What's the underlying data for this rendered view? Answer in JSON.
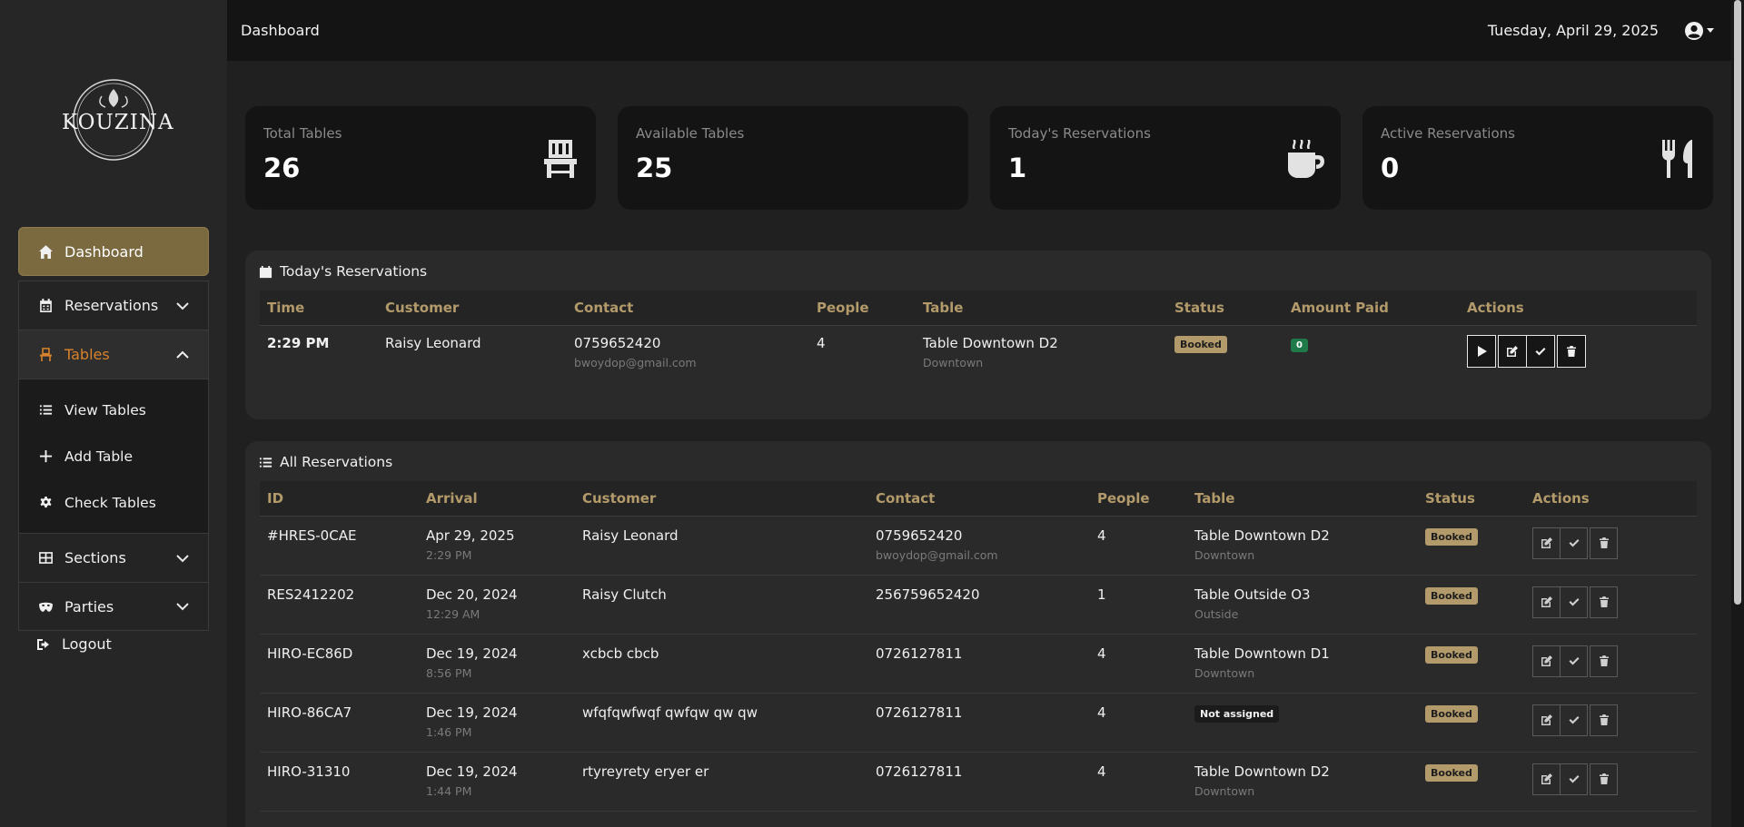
{
  "brand": {
    "logo_text": "KOUZINA"
  },
  "sidebar": {
    "items": [
      {
        "label": "Dashboard"
      },
      {
        "label": "Reservations"
      },
      {
        "label": "Tables"
      },
      {
        "label": "Sections"
      },
      {
        "label": "Parties"
      }
    ],
    "tables_sub": [
      {
        "label": "View Tables"
      },
      {
        "label": "Add Table"
      },
      {
        "label": "Check Tables"
      }
    ],
    "logout": "Logout"
  },
  "topbar": {
    "title": "Dashboard",
    "date": "Tuesday, April 29, 2025"
  },
  "stats": [
    {
      "label": "Total Tables",
      "value": "26",
      "icon": "chair-icon"
    },
    {
      "label": "Available Tables",
      "value": "25",
      "icon": ""
    },
    {
      "label": "Today's Reservations",
      "value": "1",
      "icon": "coffee-icon"
    },
    {
      "label": "Active Reservations",
      "value": "0",
      "icon": "utensils-icon"
    }
  ],
  "today": {
    "title": "Today's Reservations",
    "columns": [
      "Time",
      "Customer",
      "Contact",
      "People",
      "Table",
      "Status",
      "Amount Paid",
      "Actions"
    ],
    "rows": [
      {
        "time": "2:29 PM",
        "customer": "Raisy Leonard",
        "phone": "0759652420",
        "email": "bwoydop@gmail.com",
        "people": "4",
        "table": "Table Downtown D2",
        "section": "Downtown",
        "status": "Booked",
        "amount": "0"
      }
    ]
  },
  "all": {
    "title": "All Reservations",
    "columns": [
      "ID",
      "Arrival",
      "Customer",
      "Contact",
      "People",
      "Table",
      "Status",
      "Actions"
    ],
    "rows": [
      {
        "id": "#HRES-0CAE",
        "date": "Apr 29, 2025",
        "time": "2:29 PM",
        "customer": "Raisy Leonard",
        "phone": "0759652420",
        "email": "bwoydop@gmail.com",
        "people": "4",
        "table": "Table Downtown D2",
        "section": "Downtown",
        "status": "Booked"
      },
      {
        "id": "RES2412202",
        "date": "Dec 20, 2024",
        "time": "12:29 AM",
        "customer": "Raisy Clutch",
        "phone": "256759652420",
        "email": "",
        "people": "1",
        "table": "Table Outside O3",
        "section": "Outside",
        "status": "Booked"
      },
      {
        "id": "HIRO-EC86D",
        "date": "Dec 19, 2024",
        "time": "8:56 PM",
        "customer": "xcbcb cbcb",
        "phone": "0726127811",
        "email": "",
        "people": "4",
        "table": "Table Downtown D1",
        "section": "Downtown",
        "status": "Booked"
      },
      {
        "id": "HIRO-86CA7",
        "date": "Dec 19, 2024",
        "time": "1:46 PM",
        "customer": "wfqfqwfwqf qwfqw qw qw",
        "phone": "0726127811",
        "email": "",
        "people": "4",
        "table": "Not assigned",
        "section": "",
        "status": "Booked"
      },
      {
        "id": "HIRO-31310",
        "date": "Dec 19, 2024",
        "time": "1:44 PM",
        "customer": "rtyreyrety eryer er",
        "phone": "0726127811",
        "email": "",
        "people": "4",
        "table": "Table Downtown D2",
        "section": "Downtown",
        "status": "Booked"
      }
    ]
  }
}
